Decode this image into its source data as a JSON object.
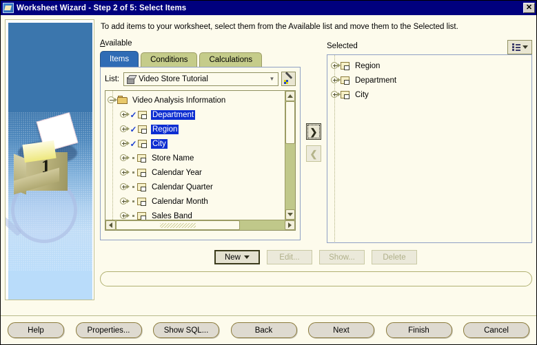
{
  "window": {
    "title": "Worksheet Wizard - Step 2 of 5: Select Items",
    "app_icon": "wizard-icon",
    "close_label": "✕",
    "titlebar_color": "#00007e",
    "background_color": "#fdfbec"
  },
  "instruction": "To add items to your worksheet, select them from the Available list and move them to the Selected list.",
  "available": {
    "label": "Available",
    "tabs": [
      {
        "label": "Items",
        "active": true
      },
      {
        "label": "Conditions",
        "active": false
      },
      {
        "label": "Calculations",
        "active": false
      }
    ],
    "list_row": {
      "label": "List:",
      "value": "Video Store Tutorial",
      "icon": "cube-icon",
      "dropdown_arrow": "▼",
      "edit_button_icon": "wand-icon"
    },
    "tree": {
      "root": {
        "label": "Video Analysis Information",
        "icon": "open-folder-icon",
        "expanded": true
      },
      "items": [
        {
          "label": "Department",
          "checked": true,
          "selected": true
        },
        {
          "label": "Region",
          "checked": true,
          "selected": true
        },
        {
          "label": "City",
          "checked": true,
          "selected": true
        },
        {
          "label": "Store Name",
          "checked": false,
          "selected": false
        },
        {
          "label": "Calendar Year",
          "checked": false,
          "selected": false
        },
        {
          "label": "Calendar Quarter",
          "checked": false,
          "selected": false
        },
        {
          "label": "Calendar Month",
          "checked": false,
          "selected": false
        },
        {
          "label": "Sales Band",
          "checked": false,
          "selected": false
        }
      ]
    }
  },
  "transfer": {
    "add_label": "❯",
    "remove_label": "❮",
    "add_enabled": true,
    "remove_enabled": false
  },
  "selected": {
    "label": "Selected",
    "view_button_icon": "list-view-icon",
    "view_button_arrow": "▼",
    "items": [
      {
        "label": "Region"
      },
      {
        "label": "Department"
      },
      {
        "label": "City"
      }
    ]
  },
  "item_actions": [
    {
      "label": "New",
      "has_menu": true,
      "enabled": true,
      "accel": "w"
    },
    {
      "label": "Edit...",
      "has_menu": false,
      "enabled": false,
      "accel": "E"
    },
    {
      "label": "Show...",
      "has_menu": false,
      "enabled": false,
      "accel": "S"
    },
    {
      "label": "Delete",
      "has_menu": false,
      "enabled": false,
      "accel": "D"
    }
  ],
  "status_bar": {
    "text": ""
  },
  "footer_buttons": [
    {
      "label": "Help",
      "accel": "H"
    },
    {
      "label": "Properties...",
      "accel": "r"
    },
    {
      "label": "Show SQL...",
      "accel": "Q"
    },
    {
      "label": "Back",
      "accel": "B"
    },
    {
      "label": "Next",
      "accel": "N"
    },
    {
      "label": "Finish",
      "accel": "F"
    },
    {
      "label": "Cancel",
      "accel": ""
    }
  ]
}
